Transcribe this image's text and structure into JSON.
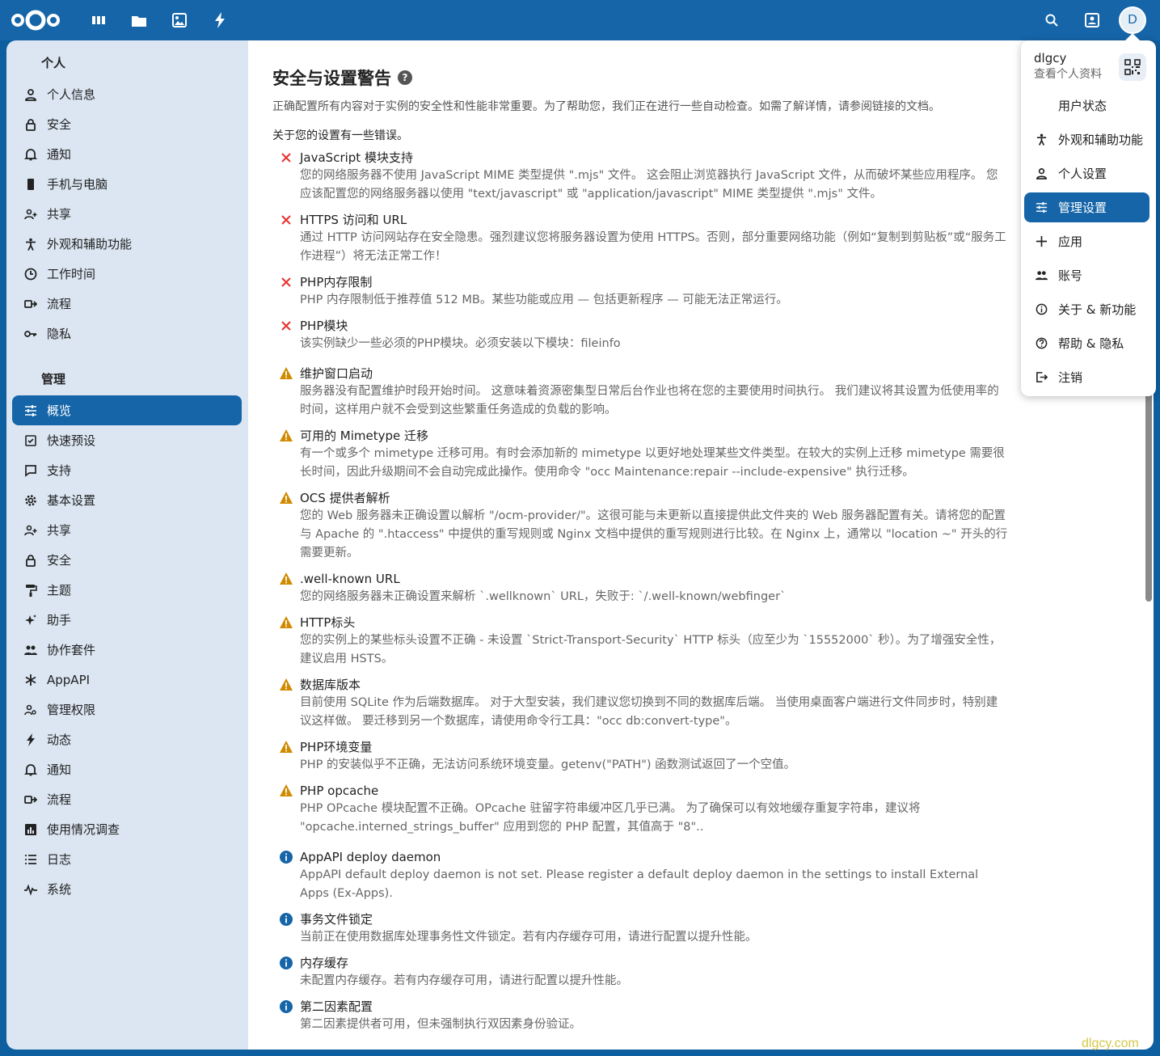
{
  "header": {
    "logo": "nextcloud-logo",
    "apps": [
      "dashboard-icon",
      "files-icon",
      "photos-icon",
      "activity-icon"
    ],
    "right": [
      "search-icon",
      "contacts-icon"
    ],
    "avatar_initial": "D"
  },
  "sidebar": {
    "personal_heading": "个人",
    "personal_items": [
      {
        "label": "个人信息",
        "icon": "user-icon"
      },
      {
        "label": "安全",
        "icon": "lock-icon"
      },
      {
        "label": "通知",
        "icon": "bell-icon"
      },
      {
        "label": "手机与电脑",
        "icon": "phone-icon"
      },
      {
        "label": "共享",
        "icon": "share-icon"
      },
      {
        "label": "外观和辅助功能",
        "icon": "accessibility-icon"
      },
      {
        "label": "工作时间",
        "icon": "clock-icon"
      },
      {
        "label": "流程",
        "icon": "flow-icon"
      },
      {
        "label": "隐私",
        "icon": "key-icon"
      }
    ],
    "admin_heading": "管理",
    "admin_items": [
      {
        "label": "概览",
        "icon": "sliders-icon",
        "active": true
      },
      {
        "label": "快速预设",
        "icon": "checklist-icon"
      },
      {
        "label": "支持",
        "icon": "chat-icon"
      },
      {
        "label": "基本设置",
        "icon": "gear-icon"
      },
      {
        "label": "共享",
        "icon": "share-icon"
      },
      {
        "label": "安全",
        "icon": "lock-icon"
      },
      {
        "label": "主题",
        "icon": "paint-roller-icon"
      },
      {
        "label": "助手",
        "icon": "sparkle-icon"
      },
      {
        "label": "协作套件",
        "icon": "group-icon"
      },
      {
        "label": "AppAPI",
        "icon": "asterisk-icon"
      },
      {
        "label": "管理权限",
        "icon": "user-key-icon"
      },
      {
        "label": "动态",
        "icon": "bolt-icon"
      },
      {
        "label": "通知",
        "icon": "bell-icon"
      },
      {
        "label": "流程",
        "icon": "flow-icon"
      },
      {
        "label": "使用情况调查",
        "icon": "bar-chart-icon"
      },
      {
        "label": "日志",
        "icon": "list-icon"
      },
      {
        "label": "系统",
        "icon": "pulse-icon"
      }
    ]
  },
  "main": {
    "title": "安全与设置警告",
    "intro": "正确配置所有内容对于实例的安全性和性能非常重要。为了帮助您，我们正在进行一些自动检查。如需了解详情，请参阅链接的文档。",
    "errors_note": "关于您的设置有一些错误。",
    "checks": [
      {
        "state": "error",
        "title": "JavaScript 模块支持",
        "desc": "您的网络服务器不使用 JavaScript MIME 类型提供 \".mjs\" 文件。 这会阻止浏览器执行 JavaScript 文件，从而破坏某些应用程序。 您应该配置您的网络服务器以使用 \"text/javascript\" 或 \"application/javascript\" MIME 类型提供 \".mjs\" 文件。"
      },
      {
        "state": "error",
        "title": "HTTPS 访问和 URL",
        "desc": "通过 HTTP 访问网站存在安全隐患。强烈建议您将服务器设置为使用 HTTPS。否则，部分重要网络功能（例如“复制到剪贴板”或“服务工作进程”）将无法正常工作！"
      },
      {
        "state": "error",
        "title": "PHP内存限制",
        "desc": "PHP 内存限制低于推荐值 512 MB。某些功能或应用 — 包括更新程序 — 可能无法正常运行。"
      },
      {
        "state": "error",
        "title": "PHP模块",
        "desc": "该实例缺少一些必须的PHP模块。必须安装以下模块：fileinfo"
      },
      {
        "state": "warning",
        "title": "维护窗口启动",
        "desc": "服务器没有配置维护时段开始时间。 这意味着资源密集型日常后台作业也将在您的主要使用时间执行。 我们建议将其设置为低使用率的时间，这样用户就不会受到这些繁重任务造成的负载的影响。"
      },
      {
        "state": "warning",
        "title": "可用的 Mimetype 迁移",
        "desc": "有一个或多个 mimetype 迁移可用。有时会添加新的 mimetype 以更好地处理某些文件类型。在较大的实例上迁移 mimetype 需要很长时间，因此升级期间不会自动完成此操作。使用命令 \"occ Maintenance:repair --include-expensive\" 执行迁移。"
      },
      {
        "state": "warning",
        "title": "OCS 提供者解析",
        "desc": "您的 Web 服务器未正确设置以解析 \"/ocm-provider/\"。这很可能与未更新以直接提供此文件夹的 Web 服务器配置有关。请将您的配置与 Apache 的 \".htaccess\" 中提供的重写规则或 Nginx 文档中提供的重写规则进行比较。在 Nginx 上，通常以 \"location ~\" 开头的行需要更新。"
      },
      {
        "state": "warning",
        "title": ".well-known URL",
        "desc": "您的网络服务器未正确设置来解析 `.wellknown` URL，失败于: `/.well-known/webfinger`"
      },
      {
        "state": "warning",
        "title": "HTTP标头",
        "desc": "您的实例上的某些标头设置不正确 - 未设置 `Strict-Transport-Security` HTTP 标头（应至少为 `15552000` 秒）。为了增强安全性，建议启用 HSTS。"
      },
      {
        "state": "warning",
        "title": "数据库版本",
        "desc": "目前使用 SQLite 作为后端数据库。 对于大型安装，我们建议您切换到不同的数据库后端。 当使用桌面客户端进行文件同步时，特别建议这样做。 要迁移到另一个数据库，请使用命令行工具：\"occ db:convert-type\"。"
      },
      {
        "state": "warning",
        "title": "PHP环境变量",
        "desc": "PHP 的安装似乎不正确，无法访问系统环境变量。getenv(\"PATH\") 函数测试返回了一个空值。"
      },
      {
        "state": "warning",
        "title": "PHP opcache",
        "desc": "PHP OPcache 模块配置不正确。OPcache 驻留字符串缓冲区几乎已满。 为了确保可以有效地缓存重复字符串，建议将 \"opcache.interned_strings_buffer\" 应用到您的 PHP 配置，其值高于 \"8\".."
      },
      {
        "state": "info",
        "title": "AppAPI deploy daemon",
        "desc": "AppAPI default deploy daemon is not set. Please register a default deploy daemon in the settings to install External Apps (Ex-Apps)."
      },
      {
        "state": "info",
        "title": "事务文件锁定",
        "desc": "当前正在使用数据库处理事务性文件锁定。若有内存缓存可用，请进行配置以提升性能。"
      },
      {
        "state": "info",
        "title": "内存缓存",
        "desc": "未配置内存缓存。若有内存缓存可用，请进行配置以提升性能。"
      },
      {
        "state": "info",
        "title": "第二因素配置",
        "desc": "第二因素提供者可用，但未强制执行双因素身份验证。"
      }
    ]
  },
  "dropdown": {
    "username": "dlgcy",
    "profile_link": "查看个人资料",
    "items": [
      {
        "label": "用户状态",
        "icon": ""
      },
      {
        "label": "外观和辅助功能",
        "icon": "accessibility-icon"
      },
      {
        "label": "个人设置",
        "icon": "user-icon"
      },
      {
        "label": "管理设置",
        "icon": "sliders-icon",
        "active": true
      },
      {
        "label": "应用",
        "icon": "plus-icon"
      },
      {
        "label": "账号",
        "icon": "group-icon"
      },
      {
        "label": "关于 & 新功能",
        "icon": "info-icon"
      },
      {
        "label": "帮助 & 隐私",
        "icon": "help-icon"
      },
      {
        "label": "注销",
        "icon": "logout-icon"
      }
    ]
  },
  "watermark": "dlgcy.com",
  "colors": {
    "primary": "#1565a8",
    "error": "#e9322d",
    "warning": "#d08a00",
    "info": "#1565a8"
  }
}
